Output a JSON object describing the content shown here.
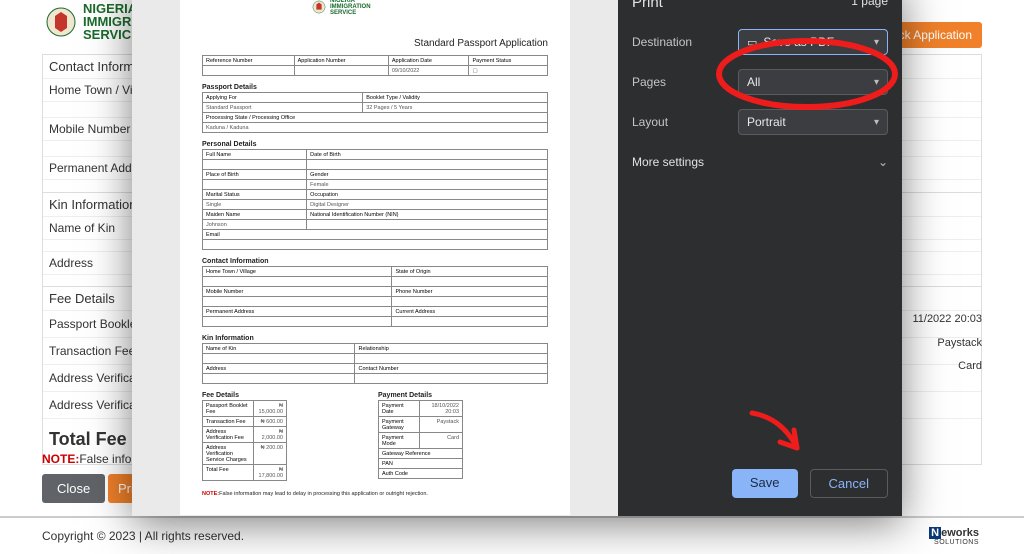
{
  "brand": {
    "name_line1": "NIGERIA",
    "name_line2": "IMMIGRATION",
    "name_line3": "SERVICE"
  },
  "header": {
    "track_btn": "Track Application"
  },
  "contact_info": {
    "title": "Contact Information",
    "home_town": "Home Town / Village",
    "mobile": "Mobile Number",
    "perm_addr": "Permanent Address"
  },
  "kin_info": {
    "title": "Kin Information",
    "name": "Name of Kin",
    "address": "Address"
  },
  "fee": {
    "title": "Fee Details",
    "booklet": "Passport Booklet Fee",
    "txn": "Transaction Fee",
    "addr_ver": "Address Verification",
    "addr_ver2": "Address Verification",
    "total_label": "Total Fee"
  },
  "payment_meta": {
    "date": "11/2022 20:03",
    "gateway": "Paystack",
    "mode": "Card"
  },
  "note": {
    "label": "NOTE:",
    "text": "False information"
  },
  "buttons": {
    "close": "Close",
    "print": "Prin"
  },
  "footer": {
    "copy": "Copyright © 2023 | All rights reserved.",
    "brand_n": "N",
    "brand_rest": "eworks",
    "brand_sub": "SOLUTIONS"
  },
  "print": {
    "title": "Print",
    "page_count": "1 page",
    "dest_label": "Destination",
    "dest_value": "Save as PDF",
    "pages_label": "Pages",
    "pages_value": "All",
    "layout_label": "Layout",
    "layout_value": "Portrait",
    "more": "More settings",
    "save": "Save",
    "cancel": "Cancel"
  },
  "doc": {
    "org": "NIGERIA\nIMMIGRATION\nSERVICE",
    "title": "Standard Passport Application",
    "hdr": {
      "ref": "Reference Number",
      "app_no": "Application Number",
      "app_date": "Application Date",
      "app_date_v": "09/10/2022",
      "pay_status": "Payment Status"
    },
    "passport": {
      "sect": "Passport Details",
      "applying_for": "Applying For",
      "applying_for_v": "Standard Passport",
      "booklet": "Booklet Type / Validity",
      "booklet_v": "32 Pages / 5 Years",
      "proc": "Processing State / Processing Office",
      "proc_v": "Kaduna / Kaduna"
    },
    "personal": {
      "sect": "Personal Details",
      "full_name": "Full Name",
      "dob": "Date of Birth",
      "pob": "Place of Birth",
      "gender": "Gender",
      "gender_v": "Female",
      "marital": "Marital Status",
      "marital_v": "Single",
      "occ": "Occupation",
      "occ_v": "Digital Designer",
      "maiden": "Maiden Name",
      "maiden_v": "Johnson",
      "nin": "National Identification Number (NIN)",
      "email": "Email"
    },
    "contact": {
      "sect": "Contact Information",
      "home": "Home Town / Village",
      "origin": "State of Origin",
      "mobile": "Mobile Number",
      "phone": "Phone Number",
      "perm": "Permanent Address",
      "cur": "Current Address"
    },
    "kin": {
      "sect": "Kin Information",
      "name": "Name of Kin",
      "rel": "Relationship",
      "addr": "Address",
      "contact": "Contact Number"
    },
    "fees": {
      "sect": "Fee Details",
      "booklet": "Passport Booklet Fee",
      "booklet_v": "₦ 15,000.00",
      "txn": "Transaction Fee",
      "txn_v": "₦ 600.00",
      "addr_ver": "Address Verification Fee",
      "addr_ver_v": "₦ 2,000.00",
      "addr_svc": "Address Verification Service Charges",
      "addr_svc_v": "₦ 200.00",
      "total": "Total Fee",
      "total_v": "₦ 17,800.00"
    },
    "pay": {
      "sect": "Payment Details",
      "date": "Payment Date",
      "date_v": "18/10/2022 20:03",
      "gateway": "Payment Gateway",
      "gateway_v": "Paystack",
      "mode": "Payment Mode",
      "mode_v": "Card",
      "ref": "Gateway Reference",
      "pan": "PAN",
      "auth": "Auth Code"
    },
    "note": {
      "b": "NOTE:",
      "t": "False information may lead to delay in processing this application or outright rejection."
    }
  }
}
